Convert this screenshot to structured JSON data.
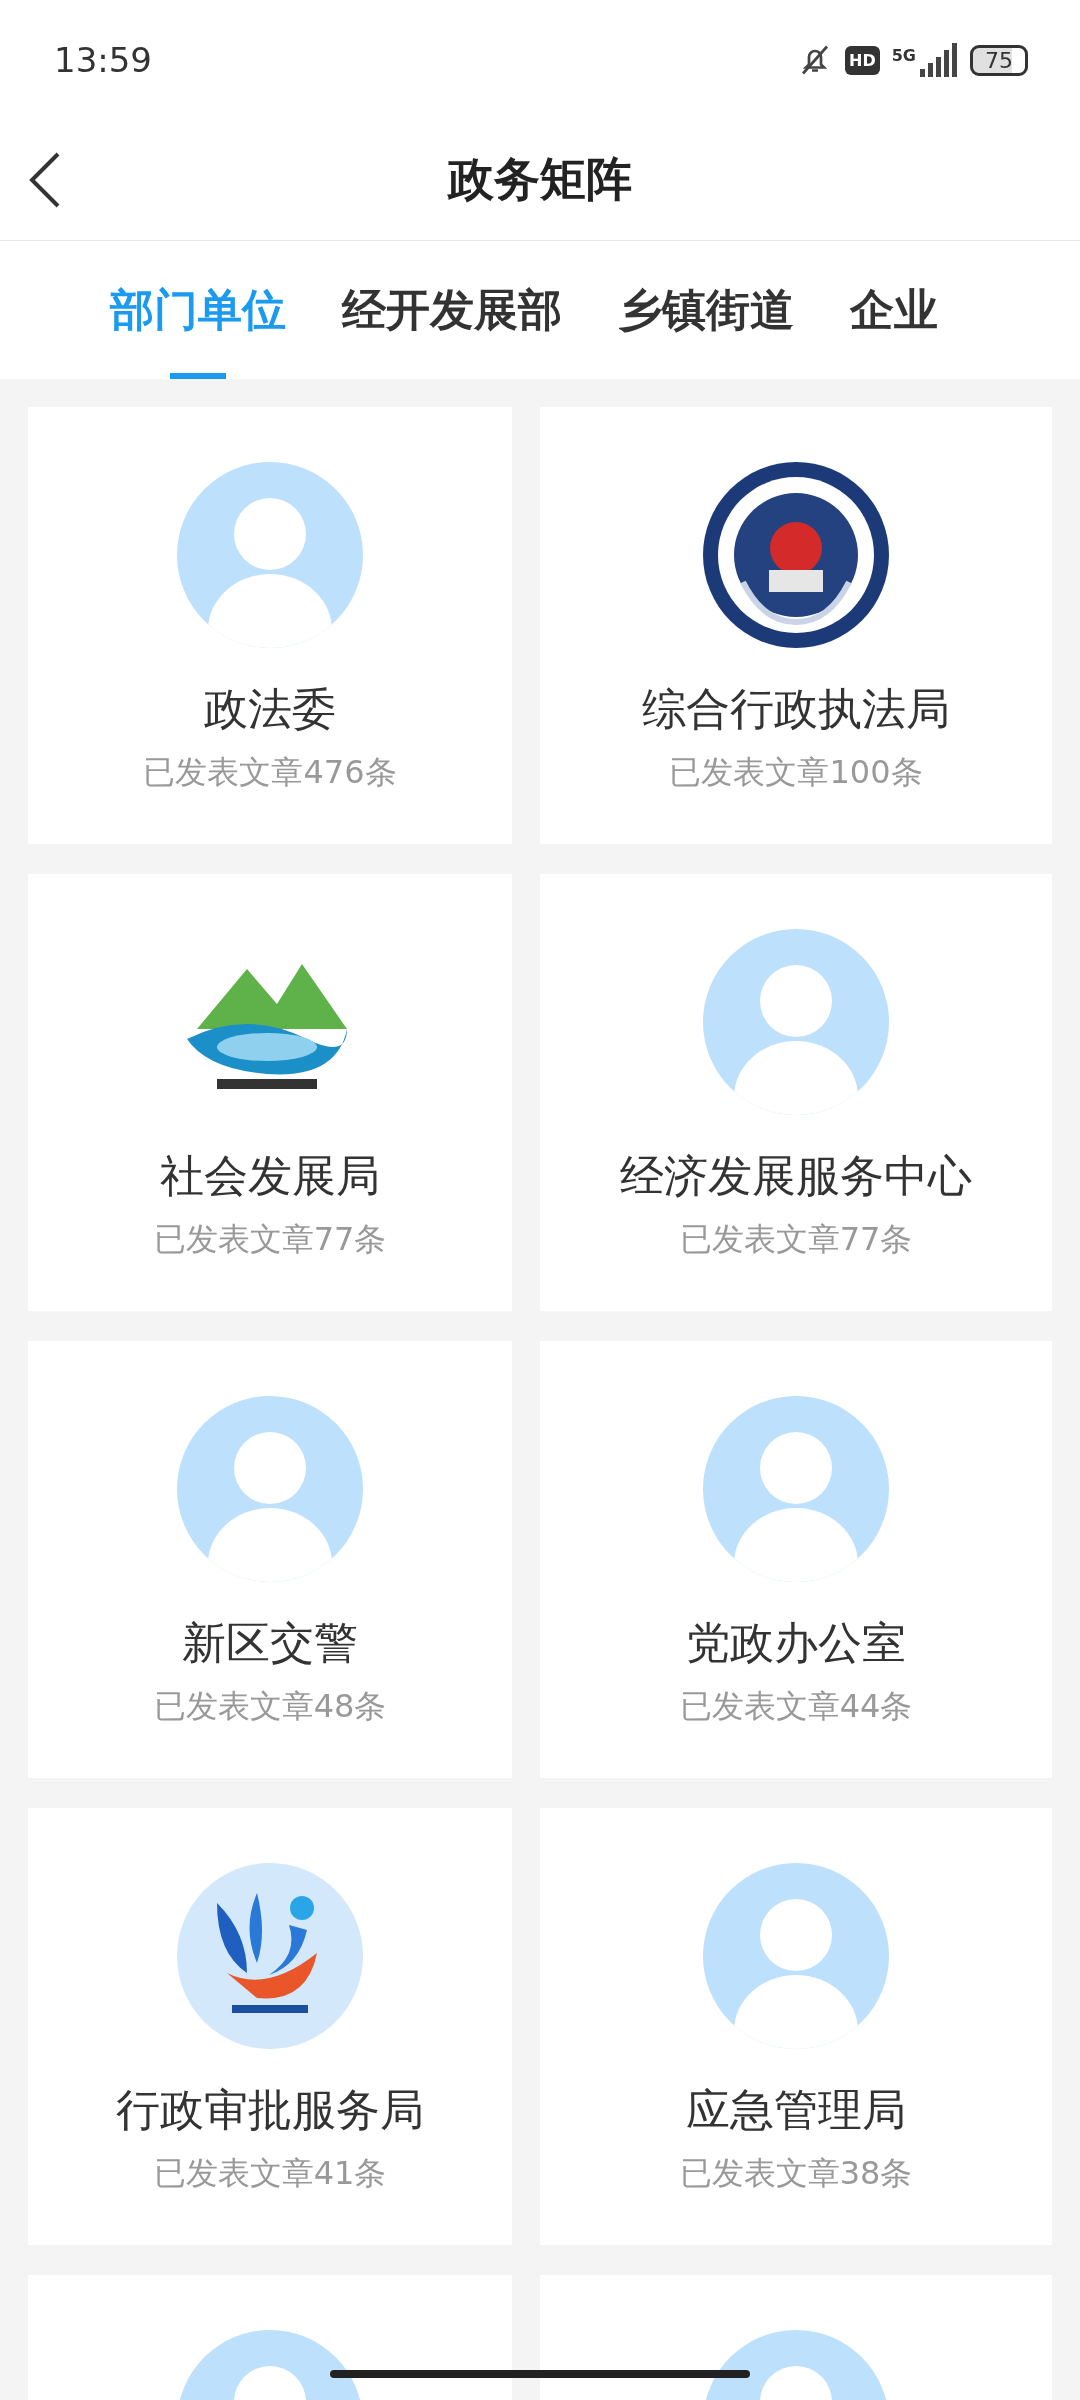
{
  "status_bar": {
    "time": "13:59",
    "network": "5G",
    "hd": "HD",
    "battery": "75"
  },
  "header": {
    "title": "政务矩阵"
  },
  "tabs": [
    {
      "label": "部门单位",
      "selected": true
    },
    {
      "label": "经开发展部",
      "selected": false
    },
    {
      "label": "乡镇街道",
      "selected": false
    },
    {
      "label": "企业",
      "selected": false
    }
  ],
  "cards": [
    {
      "kind": "avatar",
      "name": "政法委",
      "count": "已发表文章476条"
    },
    {
      "kind": "picture",
      "name": "综合行政执法局",
      "count": "已发表文章100条"
    },
    {
      "kind": "picture",
      "name": "社会发展局",
      "count": "已发表文章77条"
    },
    {
      "kind": "avatar",
      "name": "经济发展服务中心",
      "count": "已发表文章77条"
    },
    {
      "kind": "avatar",
      "name": "新区交警",
      "count": "已发表文章48条"
    },
    {
      "kind": "avatar",
      "name": "党政办公室",
      "count": "已发表文章44条"
    },
    {
      "kind": "picture",
      "name": "行政审批服务局",
      "count": "已发表文章41条"
    },
    {
      "kind": "avatar",
      "name": "应急管理局",
      "count": "已发表文章38条"
    },
    {
      "kind": "avatar"
    },
    {
      "kind": "avatar"
    }
  ]
}
